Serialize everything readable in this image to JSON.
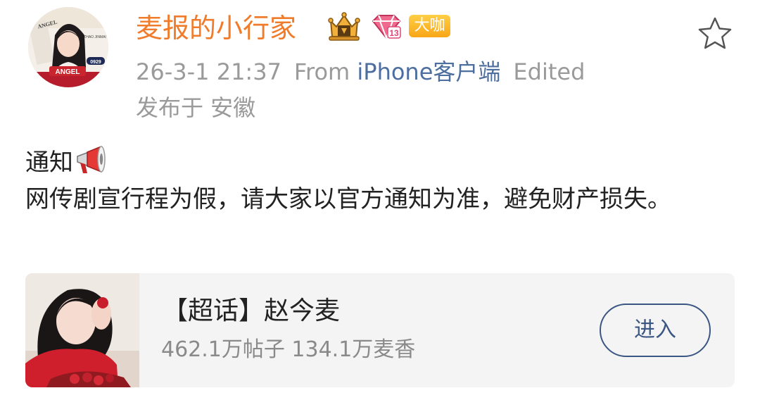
{
  "post": {
    "author": {
      "name": "麦报的小行家",
      "vip_badge": "大咖",
      "avatar_texts": [
        "ANGEL",
        "ZHAO JINMAI",
        "0929",
        "ANGEL"
      ]
    },
    "timestamp": "26-3-1 21:37",
    "source_prefix": "From",
    "source": "iPhone客户端",
    "edited_label": "Edited",
    "location": "发布于 安徽",
    "content": {
      "line1": "通知",
      "line2": "网传剧宣行程为假，请大家以官方通知为准，避免财产损失。"
    }
  },
  "supertopic_card": {
    "title": "【超话】赵今麦",
    "stats": "462.1万帖子 134.1万麦香",
    "button_label": "进入"
  },
  "colors": {
    "username": "#f07c2b",
    "source_link": "#4d6f9f",
    "meta_gray": "#9a9a9a",
    "card_bg": "#f4f4f4",
    "button_border": "#3b5683",
    "badge_gold": "#f8a617"
  },
  "icons": {
    "favorite": "star-outline-icon",
    "crown_badge": "crown-badge-icon",
    "gem_badge": "gem-badge-icon",
    "megaphone": "megaphone-emoji"
  }
}
